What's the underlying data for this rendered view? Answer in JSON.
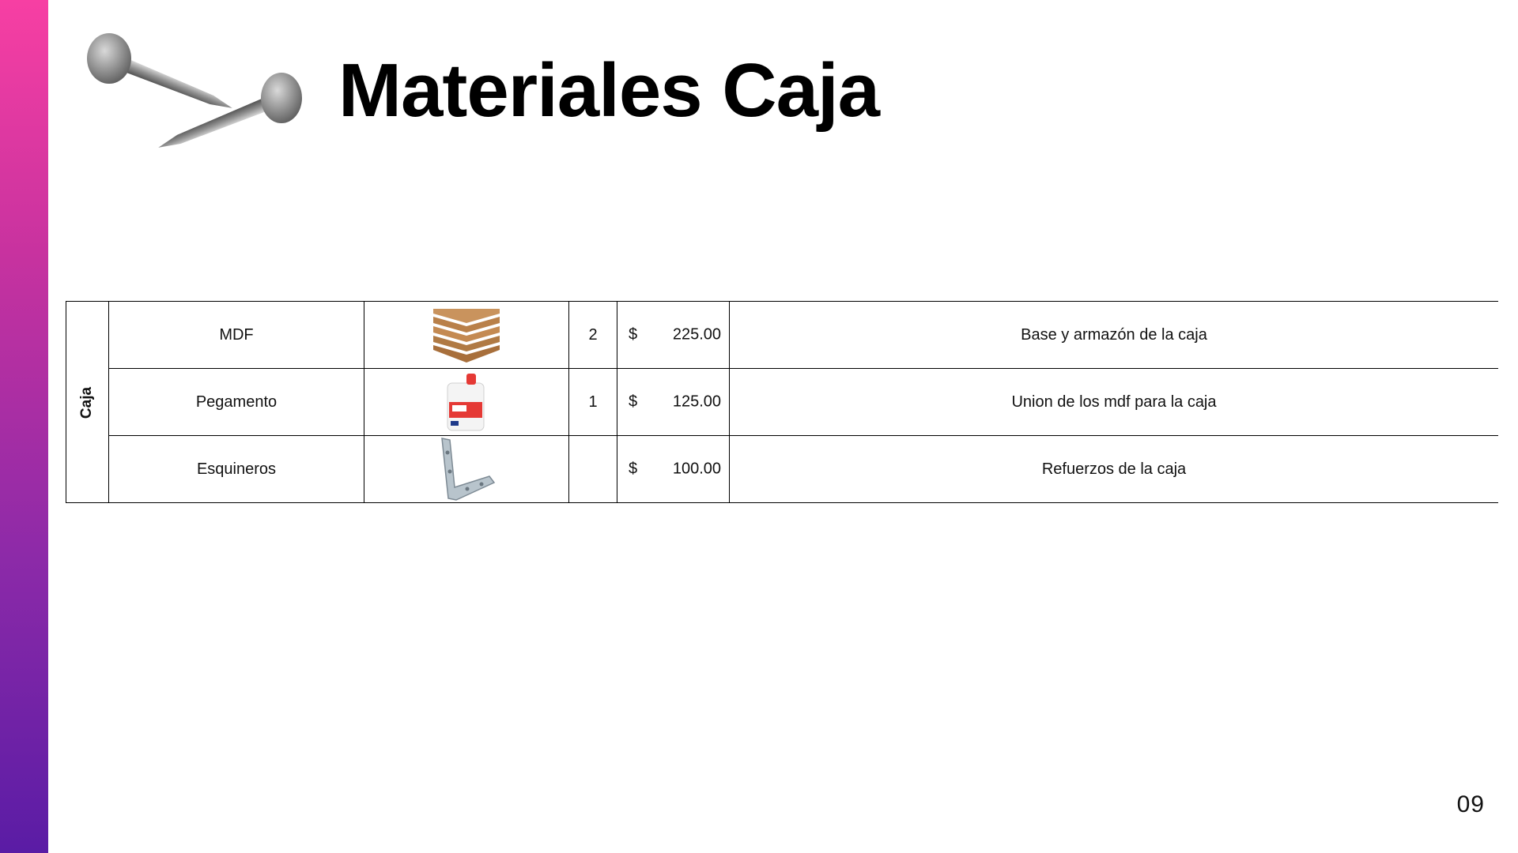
{
  "slide": {
    "title": "Materiales Caja",
    "page_number": "09",
    "accent_gradient": [
      "#f73fa3",
      "#5a1ca5"
    ]
  },
  "illustration": {
    "icon": "nails-icon"
  },
  "table": {
    "group_label": "Caja",
    "rows": [
      {
        "material": "MDF",
        "image": "mdf-boards-icon",
        "quantity": "2",
        "currency": "$",
        "price": "225.00",
        "description": "Base y armazón de la caja"
      },
      {
        "material": "Pegamento",
        "image": "glue-bottle-icon",
        "quantity": "1",
        "currency": "$",
        "price": "125.00",
        "description": "Union de los mdf para la caja"
      },
      {
        "material": "Esquineros",
        "image": "corner-bracket-icon",
        "quantity": "",
        "currency": "$",
        "price": "100.00",
        "description": "Refuerzos de la caja"
      }
    ]
  }
}
